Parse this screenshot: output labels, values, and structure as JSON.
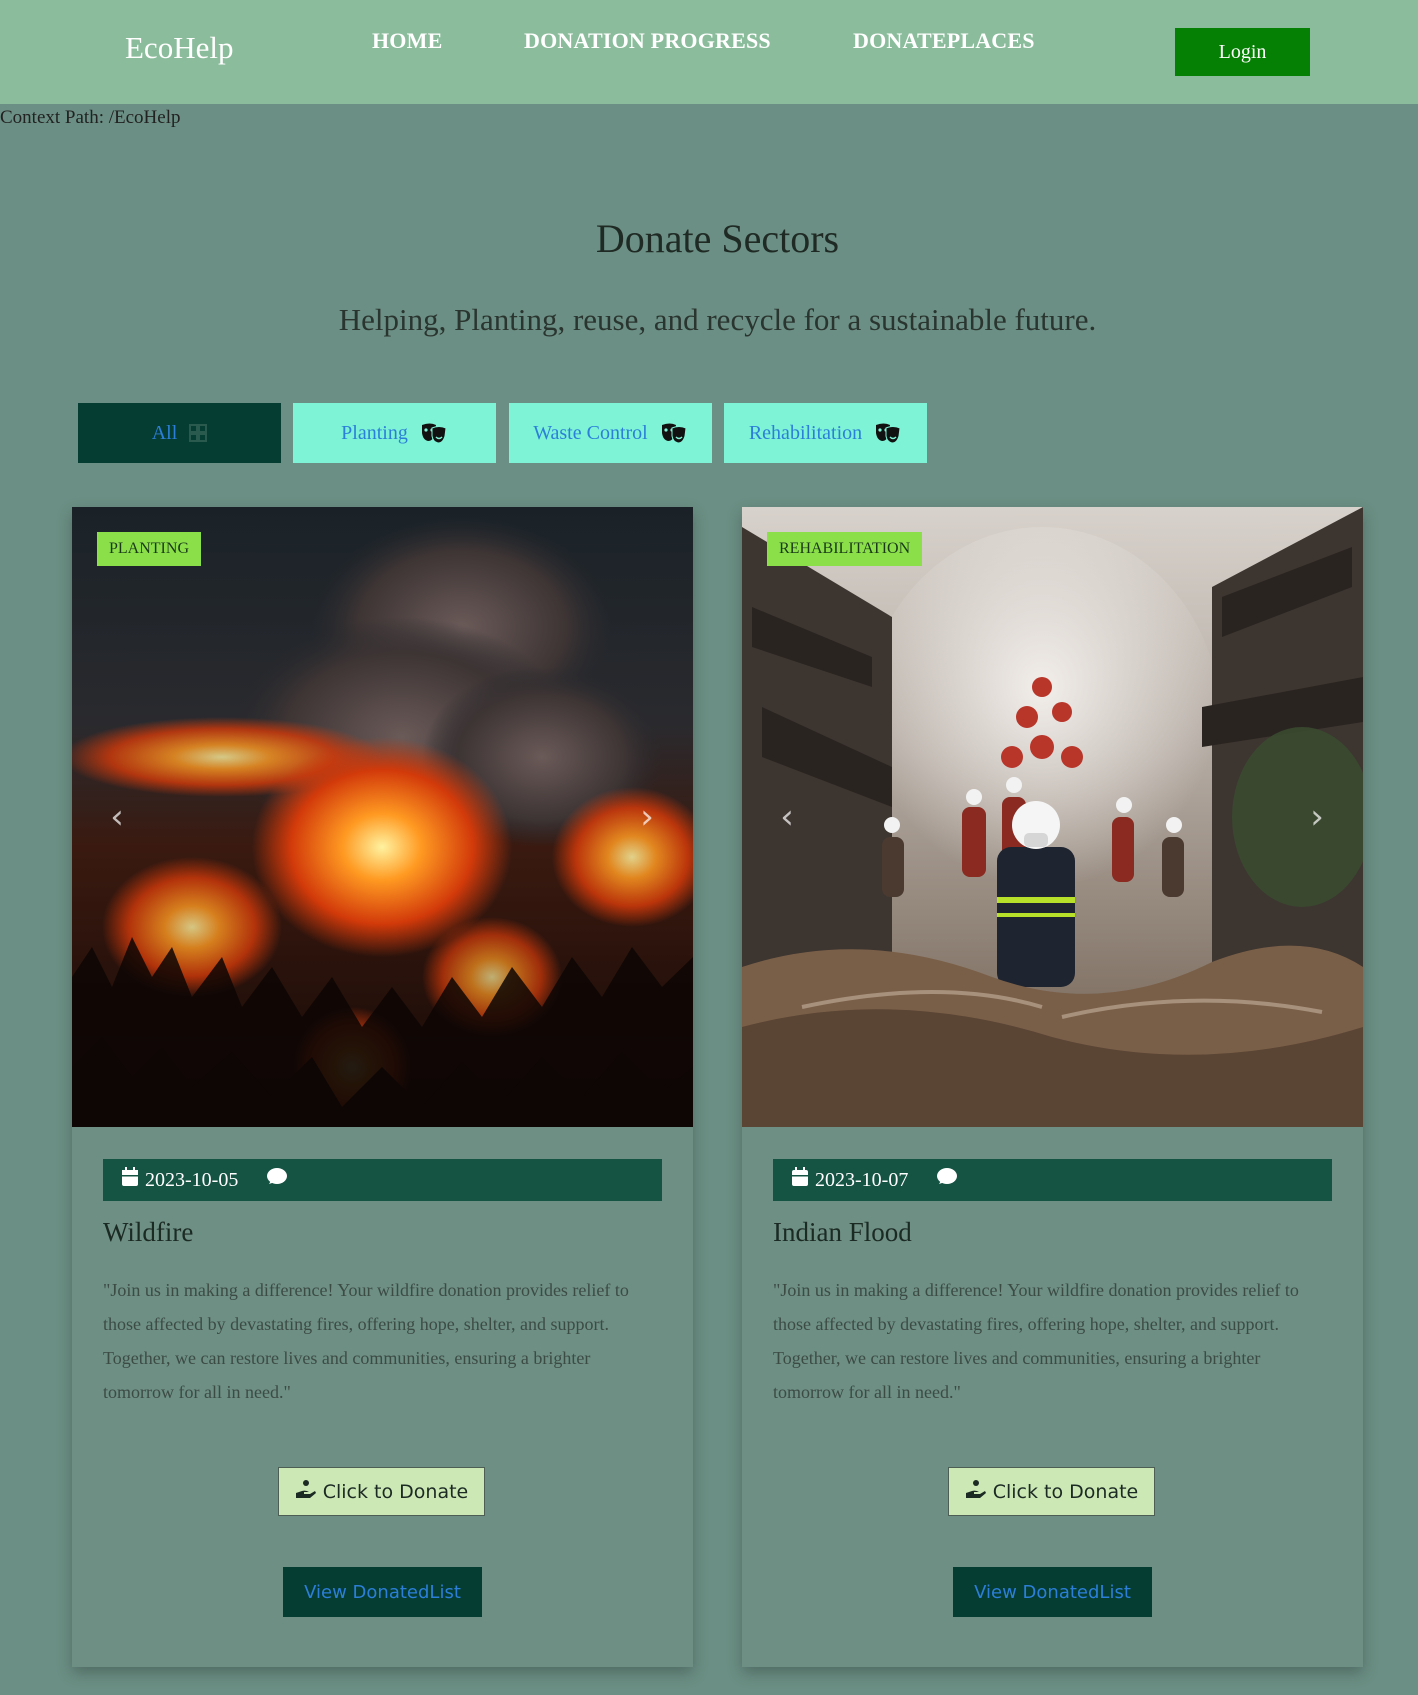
{
  "nav": {
    "brand": "EcoHelp",
    "links": [
      "HOME",
      "DONATION PROGRESS",
      "DONATEPLACES"
    ],
    "login": "Login"
  },
  "context_path": "Context Path: /EcoHelp",
  "section": {
    "title": "Donate Sectors",
    "subtitle": "Helping, Planting, reuse, and recycle for a sustainable future."
  },
  "filters": [
    {
      "label": "All",
      "icon": "grid-icon",
      "active": true
    },
    {
      "label": "Planting",
      "icon": "masks-icon",
      "active": false
    },
    {
      "label": "Waste Control",
      "icon": "masks-icon",
      "active": false
    },
    {
      "label": "Rehabilitation",
      "icon": "masks-icon",
      "active": false
    }
  ],
  "cards": [
    {
      "tag": "PLANTING",
      "date": "2023-10-05",
      "title": "Wildfire",
      "description": "\"Join us in making a difference! Your wildfire donation provides relief to those affected by devastating fires, offering hope, shelter, and support. Together, we can restore lives and communities, ensuring a brighter tomorrow for all in need.\"",
      "donate_label": "Click to Donate",
      "view_label": "View DonatedList"
    },
    {
      "tag": "REHABILITATION",
      "date": "2023-10-07",
      "title": "Indian Flood",
      "description": "\"Join us in making a difference! Your wildfire donation provides relief to those affected by devastating fires, offering hope, shelter, and support. Together, we can restore lives and communities, ensuring a brighter tomorrow for all in need.\"",
      "donate_label": "Click to Donate",
      "view_label": "View DonatedList"
    }
  ],
  "colors": {
    "navbar": "#8bbd9c",
    "page_bg": "#6b8f84",
    "login": "#058004",
    "filter_active": "#053d33",
    "filter": "#7ef3d6",
    "tag": "#8be04a",
    "meta_bar": "#155343"
  }
}
